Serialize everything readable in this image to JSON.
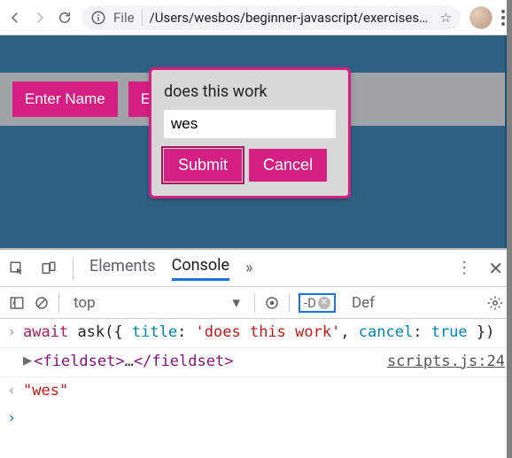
{
  "omnibar": {
    "scheme_label": "File",
    "path": "/Users/wesbos/beginner-javascript/exercises/7..."
  },
  "page": {
    "buttons": [
      "Enter Name",
      "En"
    ],
    "popup": {
      "title": "does this work",
      "input_value": "wes",
      "submit_label": "Submit",
      "cancel_label": "Cancel"
    }
  },
  "devtools": {
    "tabs": {
      "elements": "Elements",
      "console": "Console"
    },
    "toolbar": {
      "context": "top",
      "filter_text": "-D",
      "levels_label": "Def"
    },
    "lines": {
      "l1_kw": "await",
      "l1_fn": "ask",
      "l1_punc_open": "({ ",
      "l1_k1": "title",
      "l1_colon1": ": ",
      "l1_str": "'does this work'",
      "l1_comma": ", ",
      "l1_k2": "cancel",
      "l1_colon2": ": ",
      "l1_bool": "true",
      "l1_punc_close": " })",
      "l2_open": "<fieldset>",
      "l2_dots": "…",
      "l2_close": "</fieldset>",
      "l2_link": "scripts.js:24",
      "l3": "\"wes\""
    }
  }
}
